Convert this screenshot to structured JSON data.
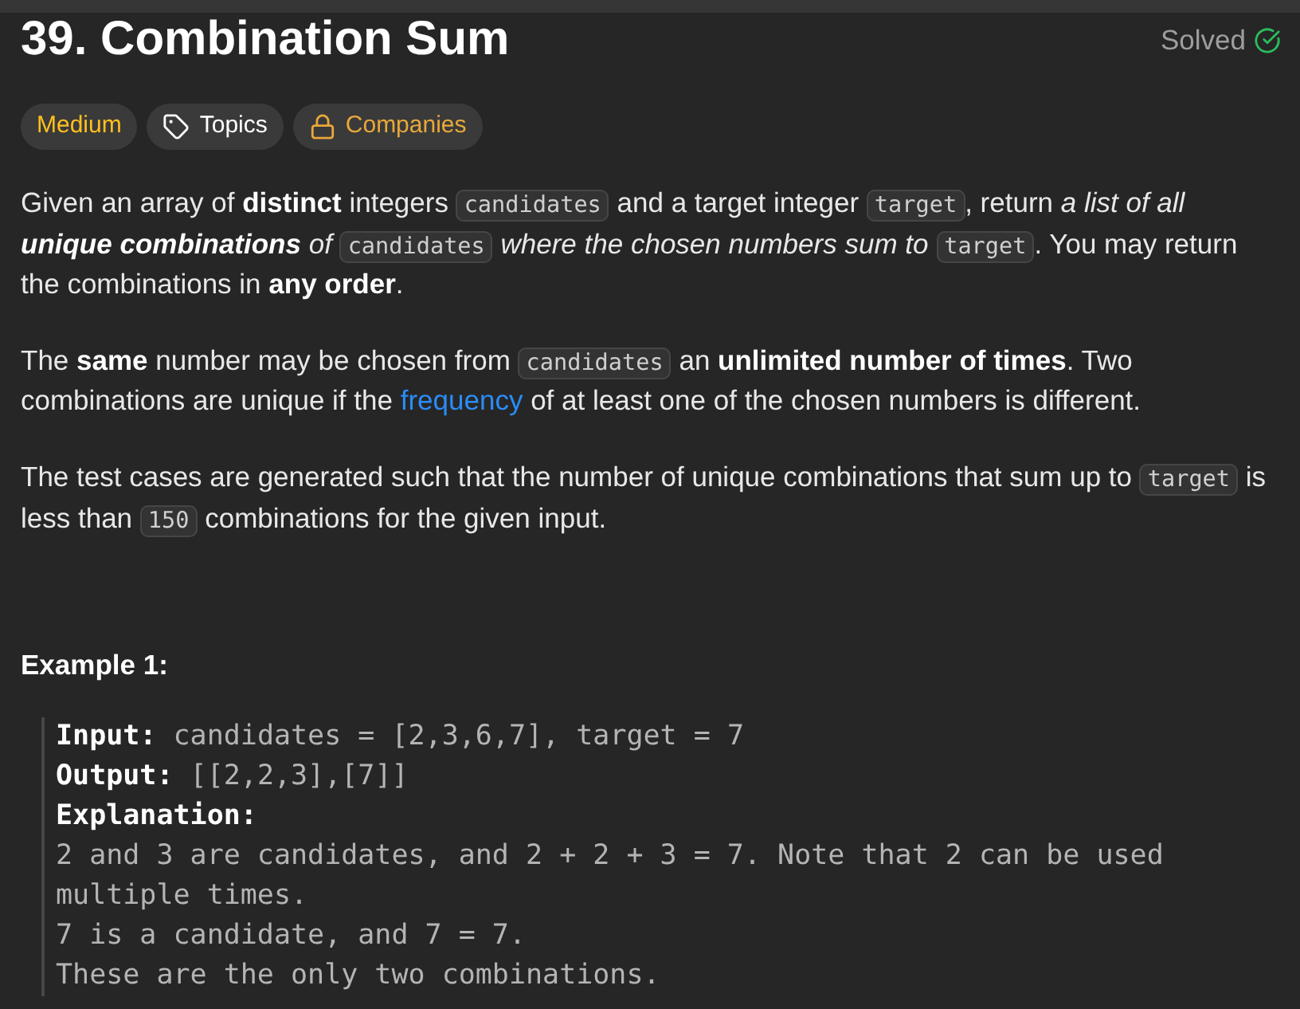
{
  "title": "39. Combination Sum",
  "status": {
    "text": "Solved",
    "solved": true
  },
  "tags": [
    {
      "kind": "difficulty",
      "label": "Medium"
    },
    {
      "kind": "topics",
      "label": "Topics"
    },
    {
      "kind": "companies",
      "label": "Companies"
    }
  ],
  "paragraphs": [
    [
      {
        "kind": "plain",
        "text": "Given an array of "
      },
      {
        "kind": "bold",
        "text": "distinct"
      },
      {
        "kind": "plain",
        "text": " integers "
      },
      {
        "kind": "code",
        "text": "candidates"
      },
      {
        "kind": "plain",
        "text": " and a target integer "
      },
      {
        "kind": "code",
        "text": "target"
      },
      {
        "kind": "plain",
        "text": ", return "
      },
      {
        "kind": "italic",
        "text": "a list of all "
      },
      {
        "kind": "bold_italic",
        "text": "unique combinations"
      },
      {
        "kind": "italic",
        "text": " of "
      },
      {
        "kind": "code",
        "text": "candidates"
      },
      {
        "kind": "italic",
        "text": " where the chosen numbers sum to "
      },
      {
        "kind": "code",
        "text": "target"
      },
      {
        "kind": "plain",
        "text": ". You may return the combinations in "
      },
      {
        "kind": "bold",
        "text": "any order"
      },
      {
        "kind": "plain",
        "text": "."
      }
    ],
    [
      {
        "kind": "plain",
        "text": "The "
      },
      {
        "kind": "bold",
        "text": "same"
      },
      {
        "kind": "plain",
        "text": " number may be chosen from "
      },
      {
        "kind": "code",
        "text": "candidates"
      },
      {
        "kind": "plain",
        "text": " an "
      },
      {
        "kind": "bold",
        "text": "unlimited number of times"
      },
      {
        "kind": "plain",
        "text": ". Two combinations are unique if the "
      },
      {
        "kind": "link",
        "text": "frequency"
      },
      {
        "kind": "plain",
        "text": " of at least one of the chosen numbers is different."
      }
    ],
    [
      {
        "kind": "plain",
        "text": "The test cases are generated such that the number of unique combinations that sum up to "
      },
      {
        "kind": "code",
        "text": "target"
      },
      {
        "kind": "plain",
        "text": " is less than "
      },
      {
        "kind": "code",
        "text": "150"
      },
      {
        "kind": "plain",
        "text": " combinations for the given input."
      }
    ]
  ],
  "example": {
    "title": "Example 1:",
    "lines": [
      {
        "kind": "field",
        "label": "Input:",
        "value": "candidates = [2,3,6,7], target = 7"
      },
      {
        "kind": "field",
        "label": "Output:",
        "value": "[[2,2,3],[7]]"
      },
      {
        "kind": "label",
        "label": "Explanation:"
      },
      {
        "kind": "text",
        "text": "2 and 3 are candidates, and 2 + 2 + 3 = 7. Note that 2 can be used multiple times."
      },
      {
        "kind": "text",
        "text": "7 is a candidate, and 7 = 7."
      },
      {
        "kind": "text",
        "text": "These are the only two combinations."
      }
    ]
  }
}
